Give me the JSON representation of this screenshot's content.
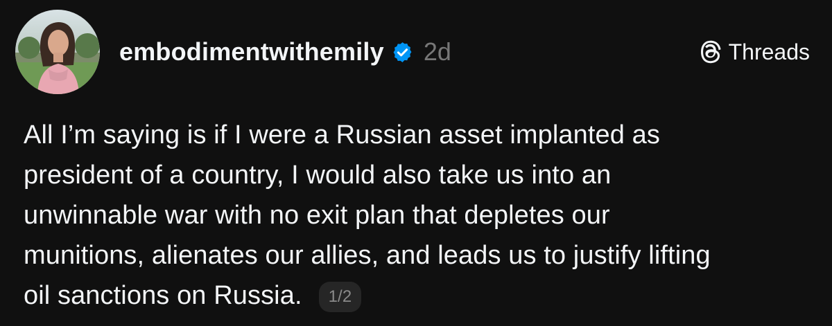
{
  "post": {
    "author": {
      "username": "embodimentwithemily",
      "verified": true,
      "avatar_alt": "profile photo"
    },
    "timestamp": "2d",
    "brand": {
      "label": "Threads",
      "icon": "threads-logo-icon"
    },
    "body_lines": [
      "All I’m saying is if I were a Russian asset implanted as",
      "president of a country, I would also take us into an",
      "unwinnable war with no exit plan that depletes our",
      "munitions, alienates our allies, and leads us to justify lifting",
      "oil sanctions on Russia."
    ],
    "page_indicator": "1/2"
  },
  "colors": {
    "background": "#101010",
    "text": "#f3f5f7",
    "muted": "#777777",
    "verified_badge": "#0095f6",
    "badge_bg": "#262626"
  }
}
